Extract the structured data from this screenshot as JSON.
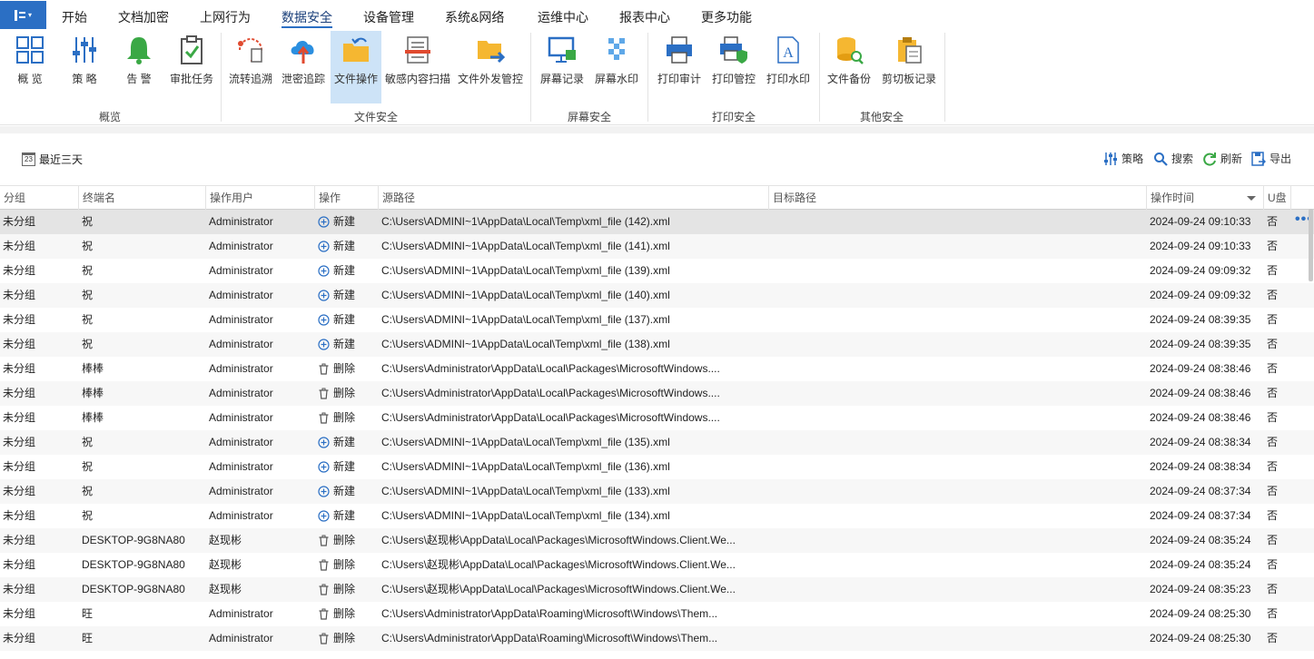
{
  "menu": {
    "tabs": [
      "开始",
      "文档加密",
      "上网行为",
      "数据安全",
      "设备管理",
      "系统&网络",
      "运维中心",
      "报表中心",
      "更多功能"
    ],
    "active_tab": "数据安全"
  },
  "ribbon": {
    "buttons": [
      "概 览",
      "策 略",
      "告 警",
      "审批任务",
      "流转追溯",
      "泄密追踪",
      "文件操作",
      "敏感内容扫描",
      "文件外发管控",
      "屏幕记录",
      "屏幕水印",
      "打印审计",
      "打印管控",
      "打印水印",
      "文件备份",
      "剪切板记录"
    ],
    "active_button": "文件操作",
    "groups": [
      "概览",
      "文件安全",
      "屏幕安全",
      "打印安全",
      "其他安全"
    ]
  },
  "toolbar": {
    "range_label": "最近三天",
    "calendar_day": "23",
    "policy": "策略",
    "search": "搜索",
    "refresh": "刷新",
    "export": "导出"
  },
  "table": {
    "headers": {
      "group": "分组",
      "terminal": "终端名",
      "user": "操作用户",
      "op": "操作",
      "src": "源路径",
      "dst": "目标路径",
      "time": "操作时间",
      "usb": "U盘"
    },
    "rows": [
      {
        "group": "未分组",
        "terminal": "祝",
        "user": "Administrator",
        "op": "新建",
        "src": "C:\\Users\\ADMINI~1\\AppData\\Local\\Temp\\xml_file (142).xml",
        "dst": "",
        "time": "2024-09-24 09:10:33",
        "usb": "否"
      },
      {
        "group": "未分组",
        "terminal": "祝",
        "user": "Administrator",
        "op": "新建",
        "src": "C:\\Users\\ADMINI~1\\AppData\\Local\\Temp\\xml_file (141).xml",
        "dst": "",
        "time": "2024-09-24 09:10:33",
        "usb": "否"
      },
      {
        "group": "未分组",
        "terminal": "祝",
        "user": "Administrator",
        "op": "新建",
        "src": "C:\\Users\\ADMINI~1\\AppData\\Local\\Temp\\xml_file (139).xml",
        "dst": "",
        "time": "2024-09-24 09:09:32",
        "usb": "否"
      },
      {
        "group": "未分组",
        "terminal": "祝",
        "user": "Administrator",
        "op": "新建",
        "src": "C:\\Users\\ADMINI~1\\AppData\\Local\\Temp\\xml_file (140).xml",
        "dst": "",
        "time": "2024-09-24 09:09:32",
        "usb": "否"
      },
      {
        "group": "未分组",
        "terminal": "祝",
        "user": "Administrator",
        "op": "新建",
        "src": "C:\\Users\\ADMINI~1\\AppData\\Local\\Temp\\xml_file (137).xml",
        "dst": "",
        "time": "2024-09-24 08:39:35",
        "usb": "否"
      },
      {
        "group": "未分组",
        "terminal": "祝",
        "user": "Administrator",
        "op": "新建",
        "src": "C:\\Users\\ADMINI~1\\AppData\\Local\\Temp\\xml_file (138).xml",
        "dst": "",
        "time": "2024-09-24 08:39:35",
        "usb": "否"
      },
      {
        "group": "未分组",
        "terminal": "棒棒",
        "user": "Administrator",
        "op": "删除",
        "src": "C:\\Users\\Administrator\\AppData\\Local\\Packages\\MicrosoftWindows....",
        "dst": "",
        "time": "2024-09-24 08:38:46",
        "usb": "否"
      },
      {
        "group": "未分组",
        "terminal": "棒棒",
        "user": "Administrator",
        "op": "删除",
        "src": "C:\\Users\\Administrator\\AppData\\Local\\Packages\\MicrosoftWindows....",
        "dst": "",
        "time": "2024-09-24 08:38:46",
        "usb": "否"
      },
      {
        "group": "未分组",
        "terminal": "棒棒",
        "user": "Administrator",
        "op": "删除",
        "src": "C:\\Users\\Administrator\\AppData\\Local\\Packages\\MicrosoftWindows....",
        "dst": "",
        "time": "2024-09-24 08:38:46",
        "usb": "否"
      },
      {
        "group": "未分组",
        "terminal": "祝",
        "user": "Administrator",
        "op": "新建",
        "src": "C:\\Users\\ADMINI~1\\AppData\\Local\\Temp\\xml_file (135).xml",
        "dst": "",
        "time": "2024-09-24 08:38:34",
        "usb": "否"
      },
      {
        "group": "未分组",
        "terminal": "祝",
        "user": "Administrator",
        "op": "新建",
        "src": "C:\\Users\\ADMINI~1\\AppData\\Local\\Temp\\xml_file (136).xml",
        "dst": "",
        "time": "2024-09-24 08:38:34",
        "usb": "否"
      },
      {
        "group": "未分组",
        "terminal": "祝",
        "user": "Administrator",
        "op": "新建",
        "src": "C:\\Users\\ADMINI~1\\AppData\\Local\\Temp\\xml_file (133).xml",
        "dst": "",
        "time": "2024-09-24 08:37:34",
        "usb": "否"
      },
      {
        "group": "未分组",
        "terminal": "祝",
        "user": "Administrator",
        "op": "新建",
        "src": "C:\\Users\\ADMINI~1\\AppData\\Local\\Temp\\xml_file (134).xml",
        "dst": "",
        "time": "2024-09-24 08:37:34",
        "usb": "否"
      },
      {
        "group": "未分组",
        "terminal": "DESKTOP-9G8NA80",
        "user": "赵现彬",
        "op": "删除",
        "src": "C:\\Users\\赵现彬\\AppData\\Local\\Packages\\MicrosoftWindows.Client.We...",
        "dst": "",
        "time": "2024-09-24 08:35:24",
        "usb": "否"
      },
      {
        "group": "未分组",
        "terminal": "DESKTOP-9G8NA80",
        "user": "赵现彬",
        "op": "删除",
        "src": "C:\\Users\\赵现彬\\AppData\\Local\\Packages\\MicrosoftWindows.Client.We...",
        "dst": "",
        "time": "2024-09-24 08:35:24",
        "usb": "否"
      },
      {
        "group": "未分组",
        "terminal": "DESKTOP-9G8NA80",
        "user": "赵现彬",
        "op": "删除",
        "src": "C:\\Users\\赵现彬\\AppData\\Local\\Packages\\MicrosoftWindows.Client.We...",
        "dst": "",
        "time": "2024-09-24 08:35:23",
        "usb": "否"
      },
      {
        "group": "未分组",
        "terminal": "旺",
        "user": "Administrator",
        "op": "删除",
        "src": "C:\\Users\\Administrator\\AppData\\Roaming\\Microsoft\\Windows\\Them...",
        "dst": "",
        "time": "2024-09-24 08:25:30",
        "usb": "否"
      },
      {
        "group": "未分组",
        "terminal": "旺",
        "user": "Administrator",
        "op": "删除",
        "src": "C:\\Users\\Administrator\\AppData\\Roaming\\Microsoft\\Windows\\Them...",
        "dst": "",
        "time": "2024-09-24 08:25:30",
        "usb": "否"
      }
    ]
  },
  "colors": {
    "accent": "#2b6fc4",
    "selected_row": "#e4e4e4",
    "ribbon_active": "#cde3f7"
  }
}
